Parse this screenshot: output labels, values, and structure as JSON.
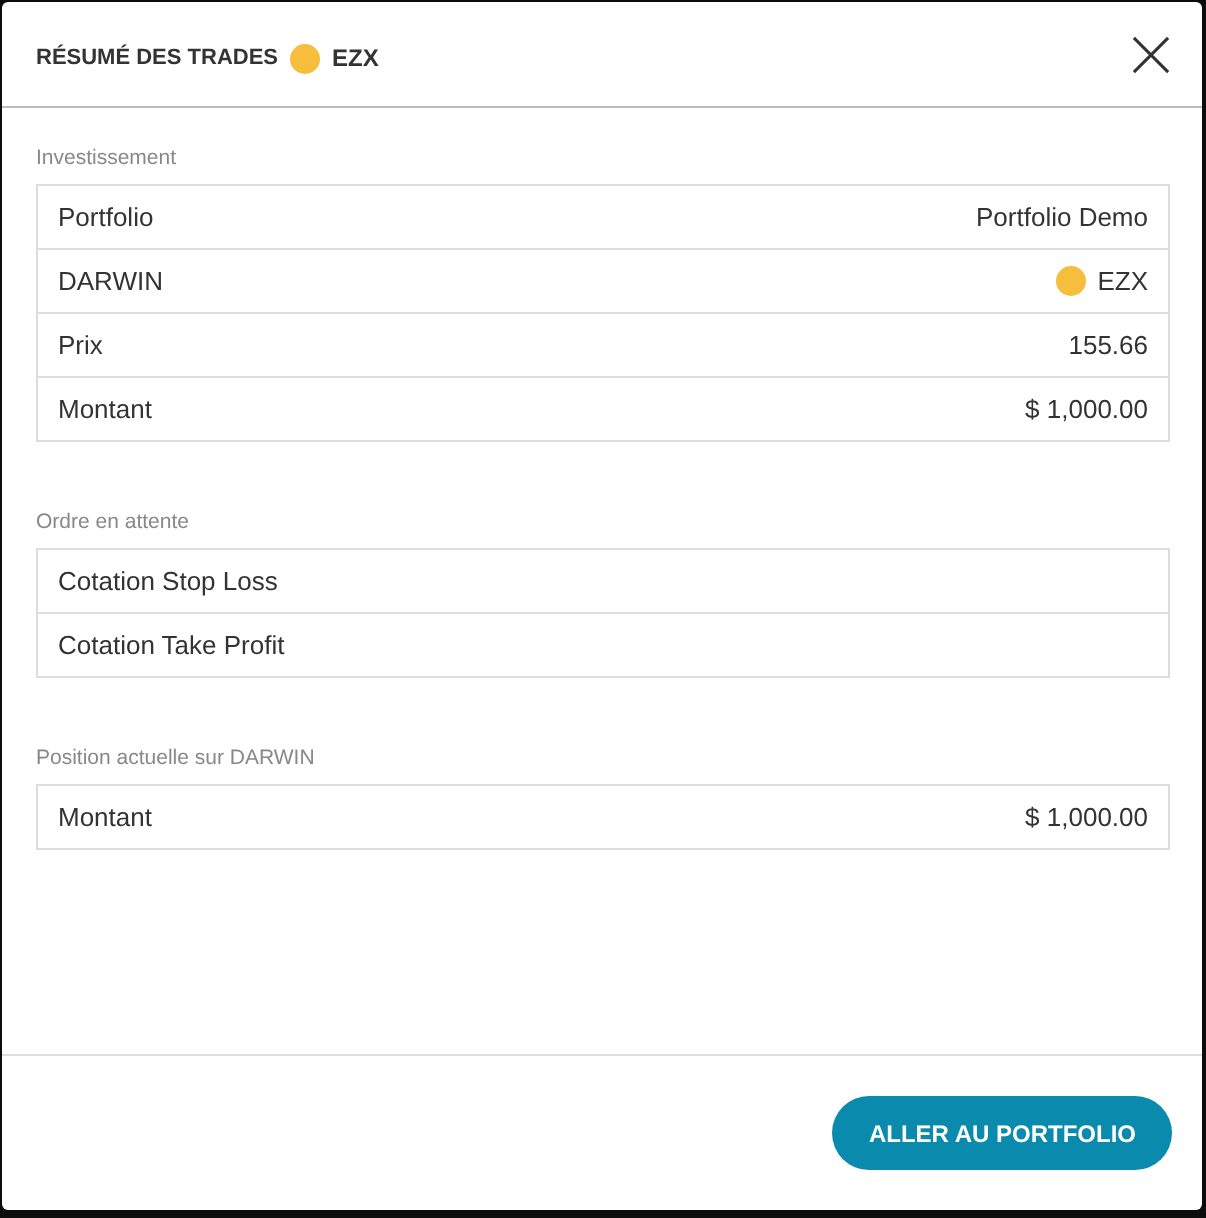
{
  "modal": {
    "title": "RÉSUMÉ DES TRADES",
    "darwin": {
      "name": "EZX",
      "color": "#f7bd3c"
    }
  },
  "sections": [
    {
      "heading": "Investissement",
      "rows": [
        {
          "kind": "text",
          "label": "Portfolio",
          "value": "Portfolio Demo"
        },
        {
          "kind": "darwin",
          "label": "DARWIN",
          "value": "EZX",
          "color": "#f7bd3c"
        },
        {
          "kind": "text",
          "label": "Prix",
          "value": "155.66"
        },
        {
          "kind": "text",
          "label": "Montant",
          "value": "$ 1,000.00"
        }
      ]
    },
    {
      "heading": "Ordre en attente",
      "rows": [
        {
          "kind": "text",
          "label": "Cotation Stop Loss"
        },
        {
          "kind": "text",
          "label": "Cotation Take Profit"
        }
      ]
    },
    {
      "heading": "Position actuelle sur DARWIN",
      "rows": [
        {
          "kind": "text",
          "label": "Montant",
          "value": "$ 1,000.00"
        }
      ]
    }
  ],
  "footer": {
    "button": "ALLER AU PORTFOLIO"
  }
}
